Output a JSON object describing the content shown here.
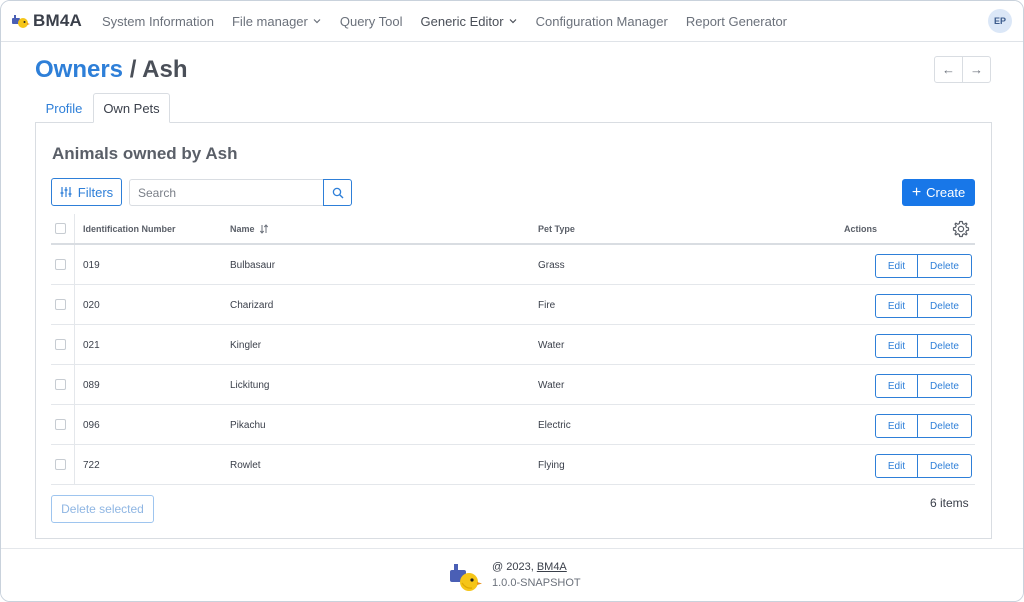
{
  "navbar": {
    "brand": "BM4A",
    "items": [
      {
        "label": "System Information",
        "has_dropdown": false
      },
      {
        "label": "File manager",
        "has_dropdown": true
      },
      {
        "label": "Query Tool",
        "has_dropdown": false
      },
      {
        "label": "Generic Editor",
        "has_dropdown": true
      },
      {
        "label": "Configuration Manager",
        "has_dropdown": false
      },
      {
        "label": "Report Generator",
        "has_dropdown": false
      }
    ],
    "avatar_initials": "EP"
  },
  "header": {
    "breadcrumb_parent": "Owners",
    "separator": " / ",
    "current": "Ash",
    "back_icon": "←",
    "forward_icon": "→"
  },
  "tabs": [
    {
      "label": "Profile",
      "active": false
    },
    {
      "label": "Own Pets",
      "active": true
    }
  ],
  "main": {
    "title": "Animals owned by Ash",
    "filters_label": "Filters",
    "search_placeholder": "Search",
    "create_label": "Create",
    "columns": {
      "id": "Identification Number",
      "name": "Name",
      "type": "Pet Type",
      "actions": "Actions"
    },
    "rows": [
      {
        "id": "019",
        "name": "Bulbasaur",
        "type": "Grass"
      },
      {
        "id": "020",
        "name": "Charizard",
        "type": "Fire"
      },
      {
        "id": "021",
        "name": "Kingler",
        "type": "Water"
      },
      {
        "id": "089",
        "name": "Lickitung",
        "type": "Water"
      },
      {
        "id": "096",
        "name": "Pikachu",
        "type": "Electric"
      },
      {
        "id": "722",
        "name": "Rowlet",
        "type": "Flying"
      }
    ],
    "edit_label": "Edit",
    "delete_label": "Delete",
    "delete_selected_label": "Delete selected",
    "items_count": "6 items"
  },
  "footer": {
    "copyright_prefix": "@ 2023, ",
    "brand_link": "BM4A",
    "version": "1.0.0-SNAPSHOT"
  },
  "colors": {
    "accent": "#2e7fd8",
    "primary_button": "#1877e8",
    "logo_blue": "#4a5fb5",
    "logo_yellow": "#f5c518"
  }
}
